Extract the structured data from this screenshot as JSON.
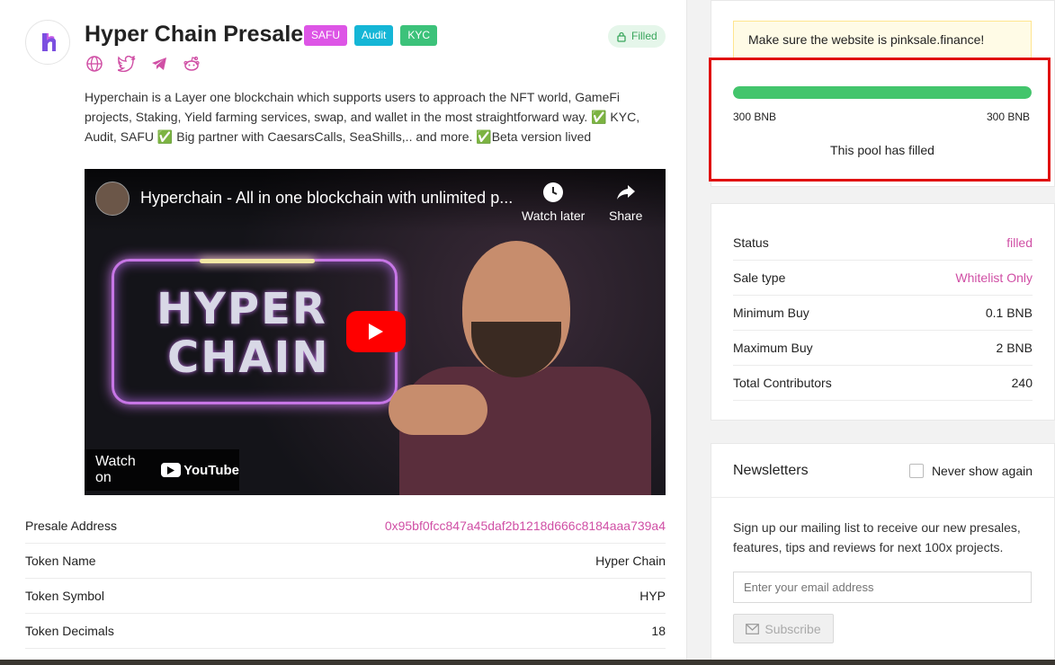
{
  "project": {
    "title": "Hyper Chain Presale",
    "badges": [
      "SAFU",
      "Audit",
      "KYC"
    ],
    "status_pill": "Filled",
    "socials": [
      "globe-icon",
      "twitter-icon",
      "telegram-icon",
      "reddit-icon"
    ],
    "description": "Hyperchain is a Layer one blockchain which supports users to approach the NFT world, GameFi projects, Staking, Yield farming services, swap, and wallet in the most straightforward way. ✅ KYC, Audit, SAFU ✅ Big partner with CaesarsCalls, SeaShills,.. and more. ✅Beta version lived"
  },
  "video": {
    "title": "Hyperchain - All in one blockchain with unlimited p...",
    "watch_later": "Watch later",
    "share": "Share",
    "watch_on": "Watch on",
    "youtube": "YouTube",
    "thumb_line1": "HYPER",
    "thumb_line2": "CHAIN"
  },
  "token_info": [
    {
      "label": "Presale Address",
      "value": "0x95bf0fcc847a45daf2b1218d666c8184aaa739a4"
    },
    {
      "label": "Token Name",
      "value": "Hyper Chain"
    },
    {
      "label": "Token Symbol",
      "value": "HYP"
    },
    {
      "label": "Token Decimals",
      "value": "18"
    }
  ],
  "pool": {
    "warning": "Make sure the website is pinksale.finance!",
    "progress": 1.0,
    "raised": "300 BNB",
    "cap": "300 BNB",
    "status_text": "This pool has filled"
  },
  "sale_info": [
    {
      "label": "Status",
      "value": "filled"
    },
    {
      "label": "Sale type",
      "value": "Whitelist Only"
    },
    {
      "label": "Minimum Buy",
      "value": "0.1 BNB"
    },
    {
      "label": "Maximum Buy",
      "value": "2 BNB"
    },
    {
      "label": "Total Contributors",
      "value": "240"
    }
  ],
  "newsletter": {
    "title": "Newsletters",
    "never_show": "Never show again",
    "text": "Sign up our mailing list to receive our new presales, features, tips and reviews for next 100x projects.",
    "placeholder": "Enter your email address",
    "subscribe": "Subscribe"
  },
  "colors": {
    "accent": "#d04fa5",
    "progress": "#43c56c",
    "highlight": "#e01010"
  }
}
